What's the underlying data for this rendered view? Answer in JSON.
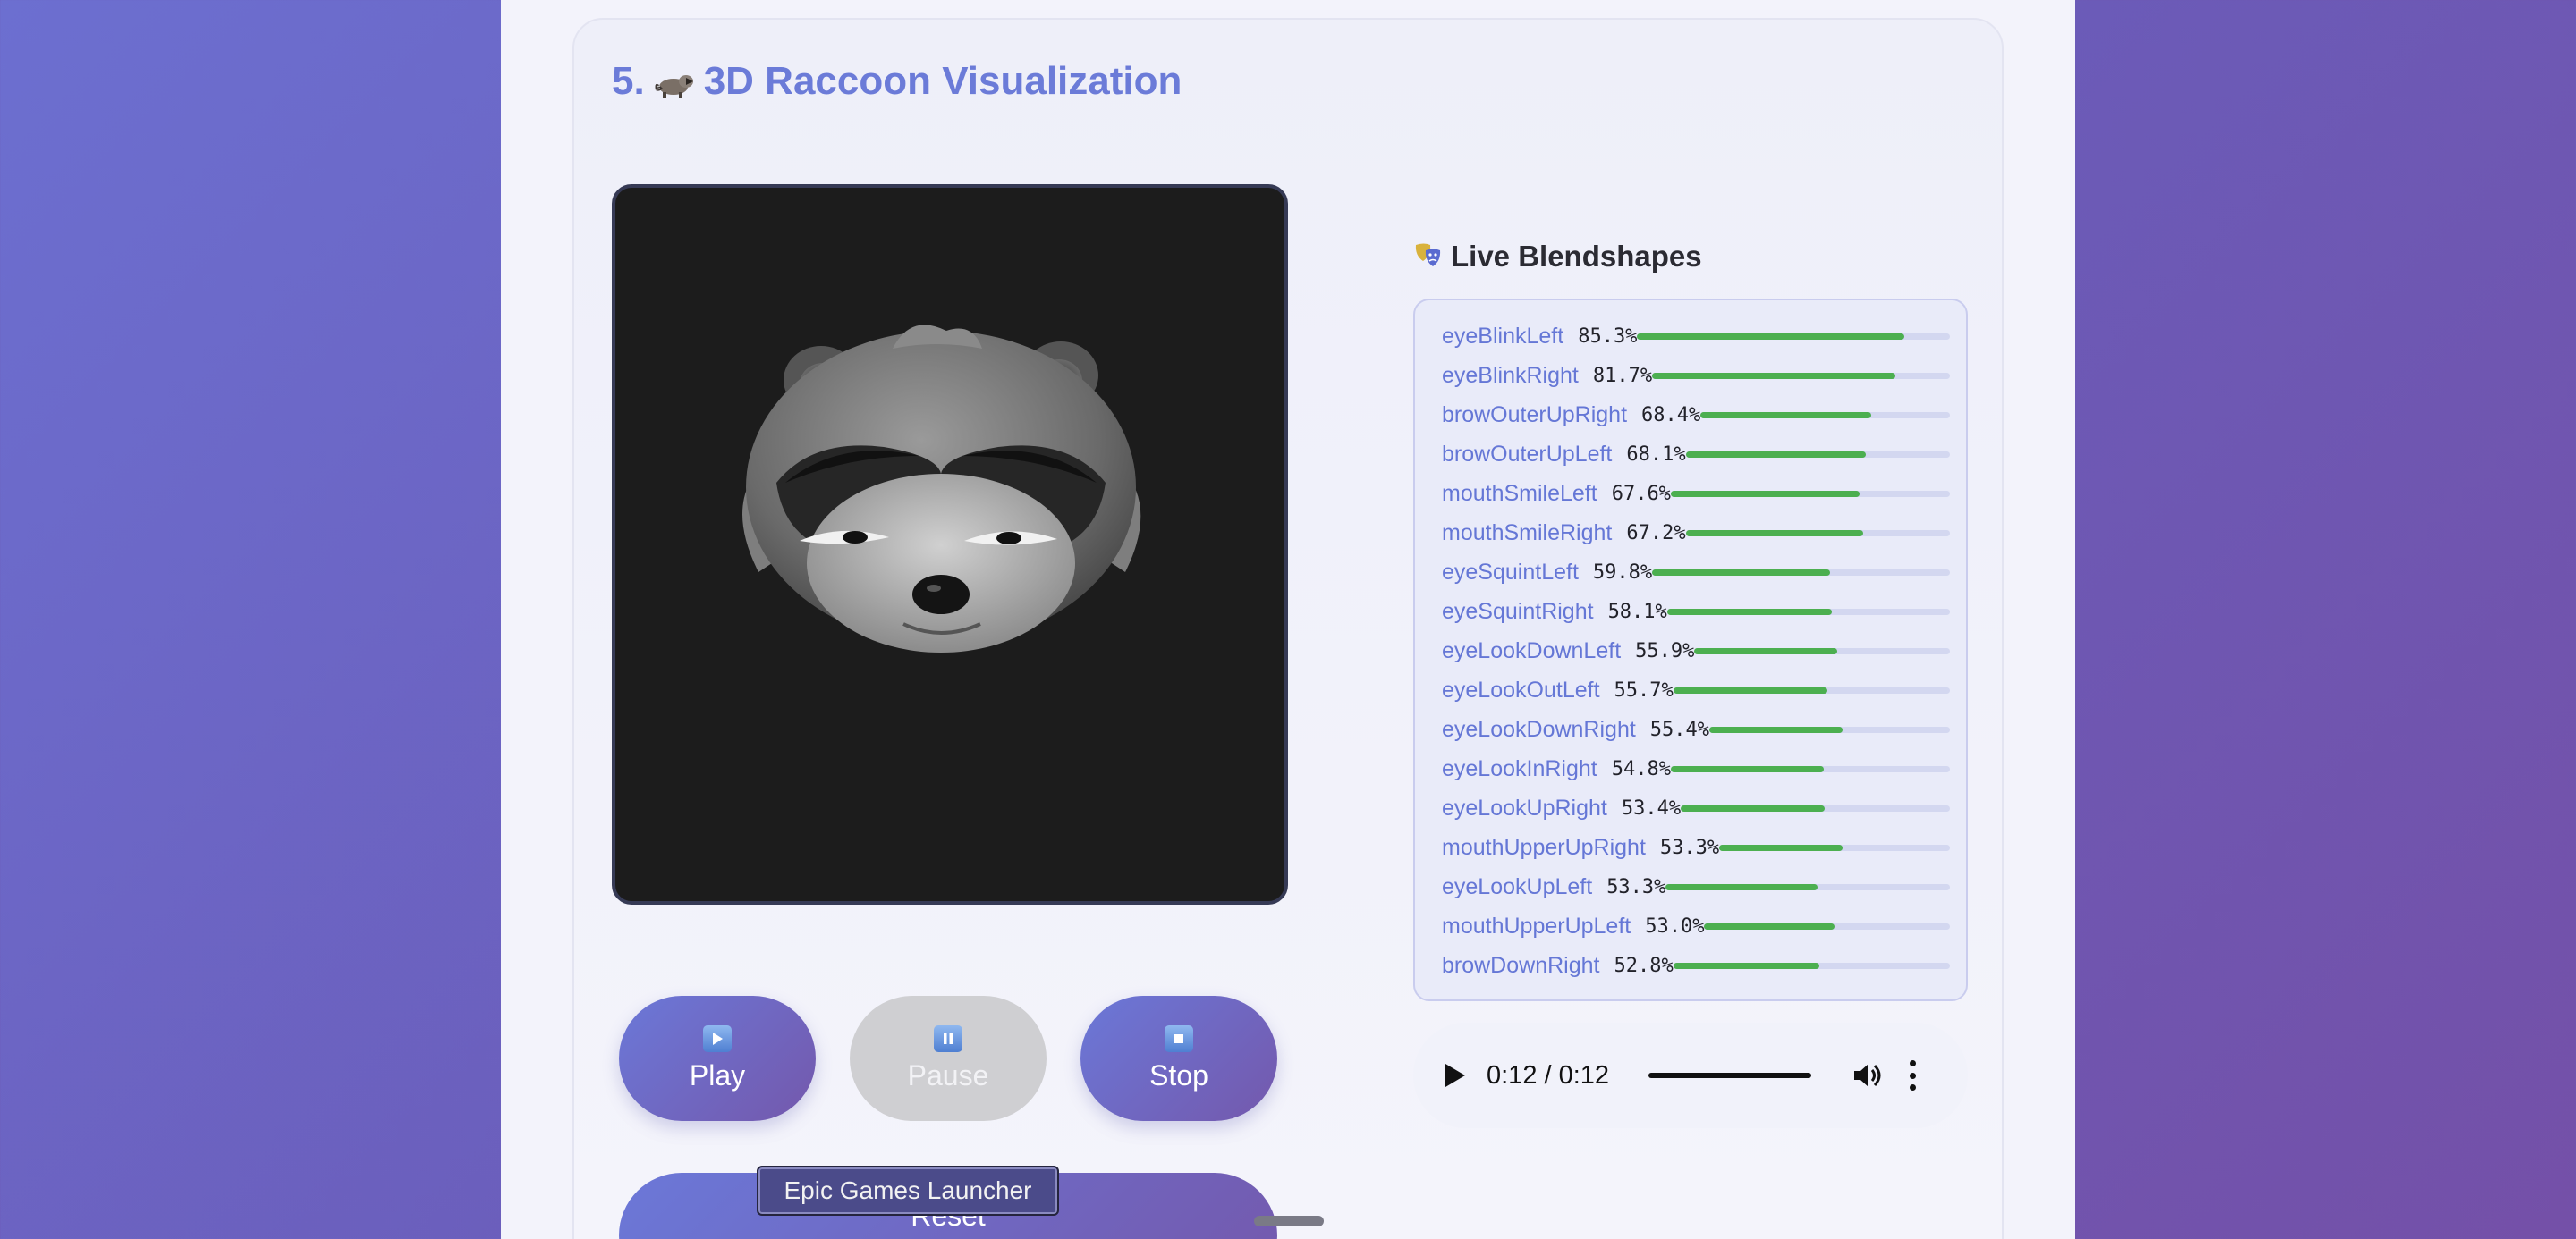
{
  "section": {
    "number": "5.",
    "title": "3D Raccoon Visualization",
    "icon": "raccoon-emoji-icon"
  },
  "controls": {
    "play": {
      "label": "Play",
      "icon": "play-button-icon"
    },
    "pause": {
      "label": "Pause",
      "icon": "pause-button-icon",
      "disabled": true
    },
    "stop": {
      "label": "Stop",
      "icon": "stop-button-icon"
    },
    "reset": {
      "label": "Reset"
    }
  },
  "tooltip": {
    "text": "Epic Games Launcher"
  },
  "blendshapes": {
    "title": "Live Blendshapes",
    "icon": "theater-masks-icon",
    "bar_color": "#4caf50",
    "items": [
      {
        "name": "eyeBlinkLeft",
        "value": "85.3%",
        "level": 0.853
      },
      {
        "name": "eyeBlinkRight",
        "value": "81.7%",
        "level": 0.817
      },
      {
        "name": "browOuterUpRight",
        "value": "68.4%",
        "level": 0.684
      },
      {
        "name": "browOuterUpLeft",
        "value": "68.1%",
        "level": 0.681
      },
      {
        "name": "mouthSmileLeft",
        "value": "67.6%",
        "level": 0.676
      },
      {
        "name": "mouthSmileRight",
        "value": "67.2%",
        "level": 0.672
      },
      {
        "name": "eyeSquintLeft",
        "value": "59.8%",
        "level": 0.598
      },
      {
        "name": "eyeSquintRight",
        "value": "58.1%",
        "level": 0.581
      },
      {
        "name": "eyeLookDownLeft",
        "value": "55.9%",
        "level": 0.559
      },
      {
        "name": "eyeLookOutLeft",
        "value": "55.7%",
        "level": 0.557
      },
      {
        "name": "eyeLookDownRight",
        "value": "55.4%",
        "level": 0.554
      },
      {
        "name": "eyeLookInRight",
        "value": "54.8%",
        "level": 0.548
      },
      {
        "name": "eyeLookUpRight",
        "value": "53.4%",
        "level": 0.534
      },
      {
        "name": "mouthUpperUpRight",
        "value": "53.3%",
        "level": 0.533
      },
      {
        "name": "eyeLookUpLeft",
        "value": "53.3%",
        "level": 0.533
      },
      {
        "name": "mouthUpperUpLeft",
        "value": "53.0%",
        "level": 0.53
      },
      {
        "name": "browDownRight",
        "value": "52.8%",
        "level": 0.528
      }
    ]
  },
  "audio": {
    "time": "0:12 / 0:12",
    "progress": 1.0
  },
  "colors": {
    "accent": "#6b7bd8",
    "button_gradient_start": "#6b78d8",
    "button_gradient_end": "#7458ac",
    "viewer_bg": "#1c1c1c"
  }
}
